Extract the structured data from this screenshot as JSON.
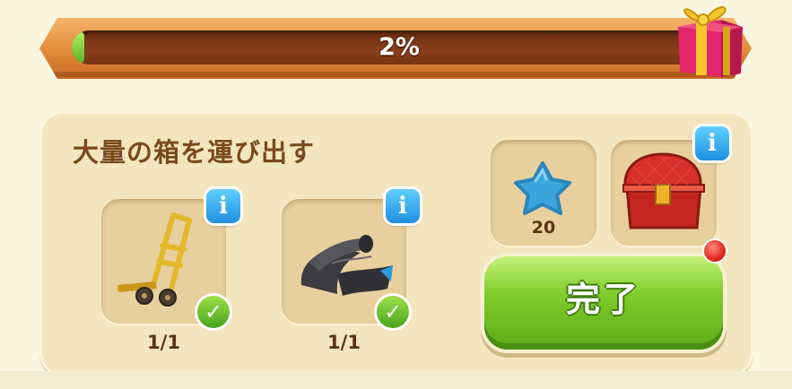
{
  "progress": {
    "percent_label": "2%",
    "value": 0.02
  },
  "quest": {
    "title": "大量の箱を運び出す",
    "requirements": [
      {
        "icon": "hand-truck-icon",
        "count": "1/1",
        "completed": true
      },
      {
        "icon": "rubber-mats-icon",
        "count": "1/1",
        "completed": true
      }
    ],
    "rewards": [
      {
        "icon": "blue-star-icon",
        "amount": "20"
      },
      {
        "icon": "red-chest-icon"
      }
    ],
    "complete_button": "完了"
  },
  "info_label": "i",
  "check_label": "✓",
  "colors": {
    "button_green": "#7fcc2b",
    "panel": "#f3e6bf",
    "progress_bar": "#8a3f1c",
    "accent_orange": "#e08a3a"
  }
}
